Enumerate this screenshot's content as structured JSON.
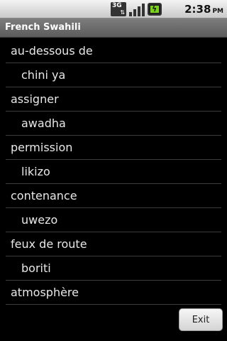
{
  "status_bar": {
    "network_badge": "3G",
    "network_icon": "3g-data-icon",
    "signal_icon": "signal-strength-icon",
    "battery_icon": "battery-charging-icon",
    "time": "2:38",
    "ampm": "PM"
  },
  "title_bar": {
    "title": "French Swahili"
  },
  "list": {
    "rows": [
      {
        "lang": "french",
        "text": "au-dessous de"
      },
      {
        "lang": "swahili",
        "text": "chini ya"
      },
      {
        "lang": "french",
        "text": "assigner"
      },
      {
        "lang": "swahili",
        "text": "awadha"
      },
      {
        "lang": "french",
        "text": "permission"
      },
      {
        "lang": "swahili",
        "text": "likizo"
      },
      {
        "lang": "french",
        "text": "contenance"
      },
      {
        "lang": "swahili",
        "text": "uwezo"
      },
      {
        "lang": "french",
        "text": "feux de route"
      },
      {
        "lang": "swahili",
        "text": "boriti"
      },
      {
        "lang": "french",
        "text": "atmosphère"
      }
    ]
  },
  "buttons": {
    "exit_label": "Exit"
  }
}
